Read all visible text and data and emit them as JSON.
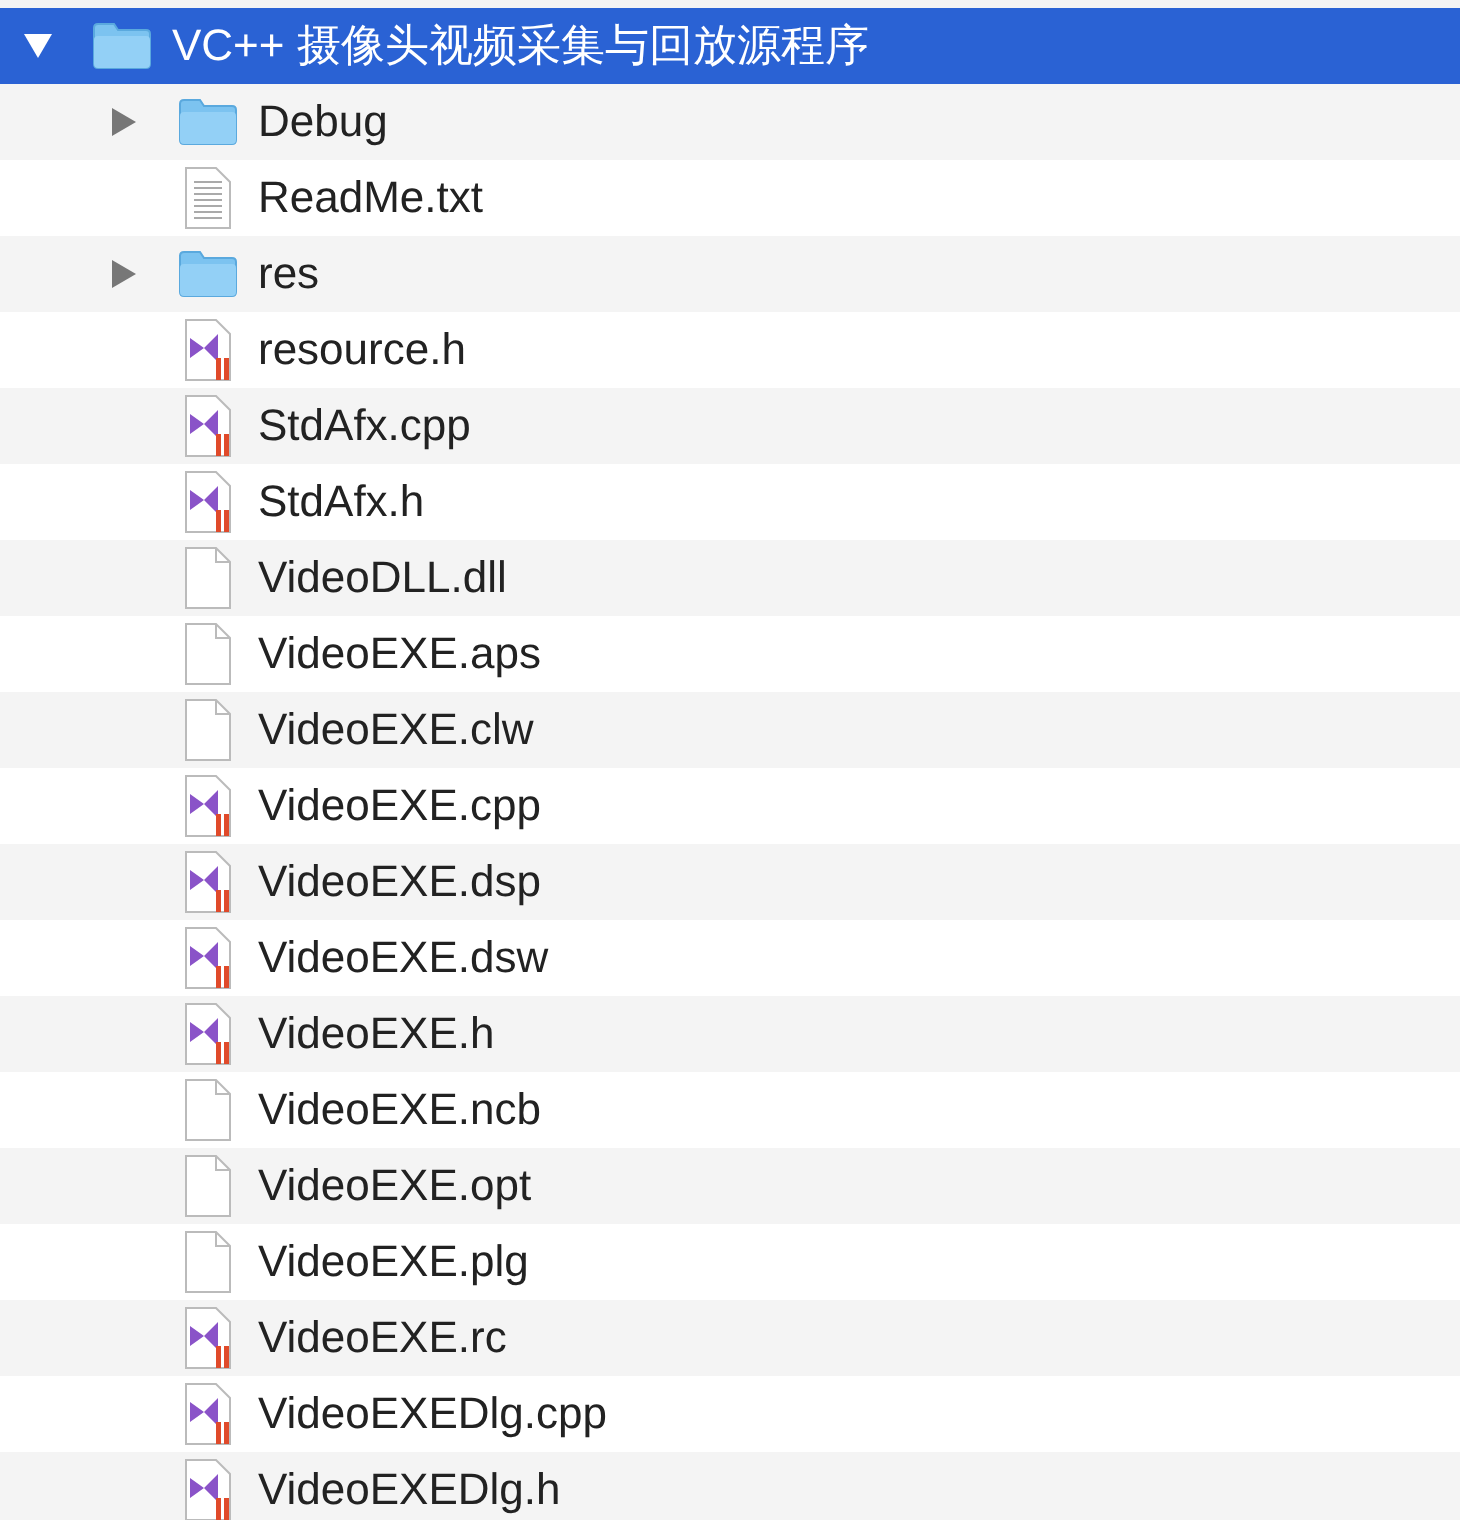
{
  "tree": [
    {
      "name": "VC++ 摄像头视频采集与回放源程序",
      "kind": "folder",
      "expanded": true,
      "selected": true,
      "children": [
        {
          "name": "Debug",
          "kind": "folder",
          "expanded": false,
          "selected": false
        },
        {
          "name": "ReadMe.txt",
          "kind": "text",
          "selected": false
        },
        {
          "name": "res",
          "kind": "folder",
          "expanded": false,
          "selected": false
        },
        {
          "name": "resource.h",
          "kind": "source",
          "selected": false
        },
        {
          "name": "StdAfx.cpp",
          "kind": "source",
          "selected": false
        },
        {
          "name": "StdAfx.h",
          "kind": "source",
          "selected": false
        },
        {
          "name": "VideoDLL.dll",
          "kind": "blank",
          "selected": false
        },
        {
          "name": "VideoEXE.aps",
          "kind": "blank",
          "selected": false
        },
        {
          "name": "VideoEXE.clw",
          "kind": "blank",
          "selected": false
        },
        {
          "name": "VideoEXE.cpp",
          "kind": "source",
          "selected": false
        },
        {
          "name": "VideoEXE.dsp",
          "kind": "source",
          "selected": false
        },
        {
          "name": "VideoEXE.dsw",
          "kind": "source",
          "selected": false
        },
        {
          "name": "VideoEXE.h",
          "kind": "source",
          "selected": false
        },
        {
          "name": "VideoEXE.ncb",
          "kind": "blank",
          "selected": false
        },
        {
          "name": "VideoEXE.opt",
          "kind": "blank",
          "selected": false
        },
        {
          "name": "VideoEXE.plg",
          "kind": "blank",
          "selected": false
        },
        {
          "name": "VideoEXE.rc",
          "kind": "source",
          "selected": false
        },
        {
          "name": "VideoEXEDlg.cpp",
          "kind": "source",
          "selected": false
        },
        {
          "name": "VideoEXEDlg.h",
          "kind": "source",
          "selected": false
        }
      ]
    }
  ]
}
